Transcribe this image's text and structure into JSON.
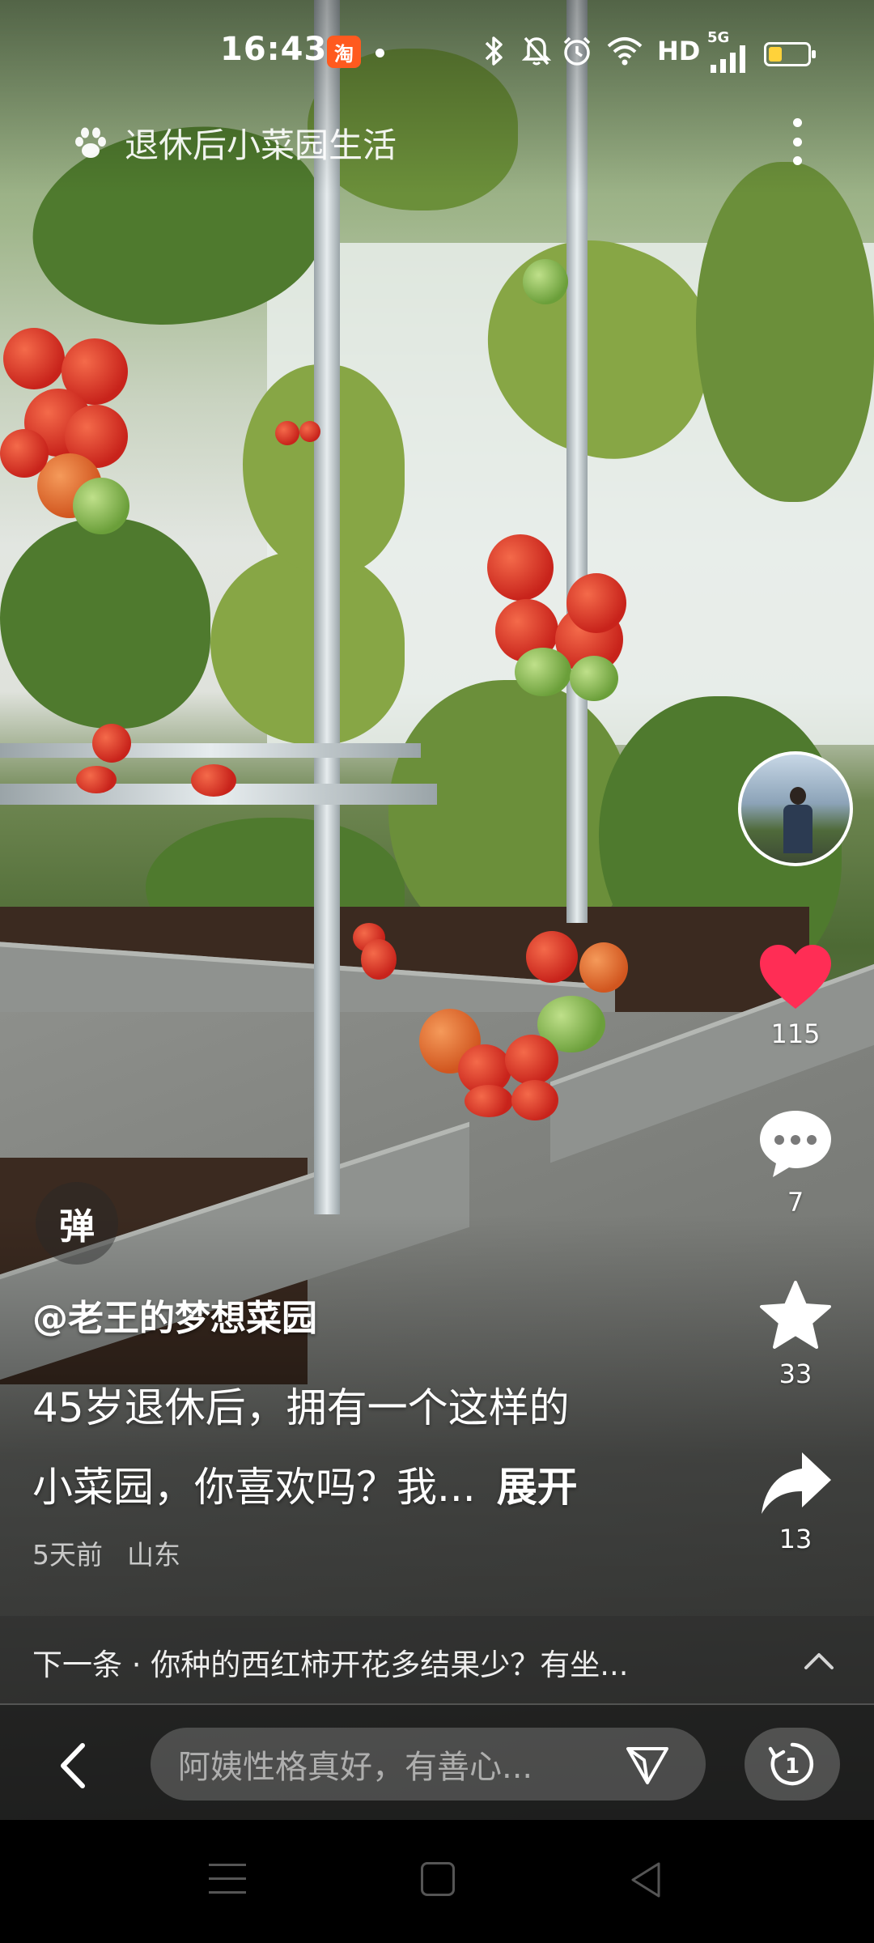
{
  "status_bar": {
    "time": "16:43",
    "app_badge": "淘",
    "network": "HD",
    "signal": "5G",
    "battery_level": 0.35,
    "icons": [
      "bluetooth-icon",
      "mute-icon",
      "alarm-icon",
      "wifi-icon",
      "signal-icon",
      "battery-icon"
    ]
  },
  "topic": {
    "icon": "paw-icon",
    "label": "退休后小菜园生活"
  },
  "actions": {
    "like_count": "115",
    "comment_count": "7",
    "favorite_count": "33",
    "share_count": "13",
    "like_color": "#ff2d55"
  },
  "danmaku_label": "弹",
  "caption": {
    "author": "@老王的梦想菜园",
    "line1": "45岁退休后，拥有一个这样的",
    "line2": "小菜园，你喜欢吗？我...",
    "expand": "展开",
    "time_ago": "5天前",
    "location": "山东"
  },
  "next_video": {
    "text": "下一条 · 你种的西红柿开花多结果少？有坐..."
  },
  "comment_input": {
    "placeholder": "阿姨性格真好，有善心..."
  },
  "replay_label": "1"
}
